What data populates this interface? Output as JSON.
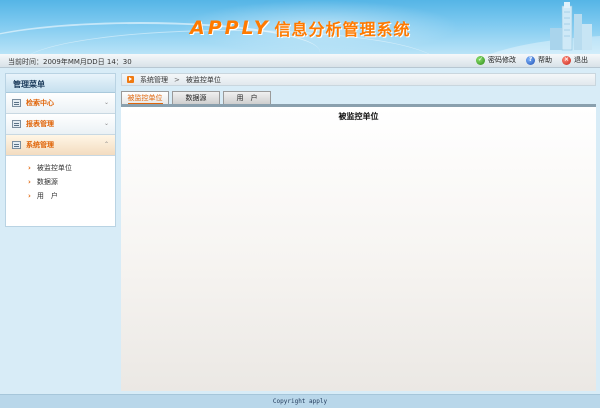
{
  "header": {
    "brand": "APPLY",
    "title": "信息分析管理系统"
  },
  "topbar": {
    "time_label": "当前时间：",
    "time_value": "2009年MM月DD日 14：30",
    "links": [
      {
        "label": "密码修改",
        "icon": "password-icon"
      },
      {
        "label": "帮助",
        "icon": "help-icon"
      },
      {
        "label": "退出",
        "icon": "exit-icon"
      }
    ]
  },
  "sidebar": {
    "title": "管理菜单",
    "items": [
      {
        "label": "检索中心",
        "icon": "search-center-icon"
      },
      {
        "label": "报表管理",
        "icon": "report-icon"
      },
      {
        "label": "系统管理",
        "icon": "system-icon"
      }
    ],
    "sub_items": [
      {
        "label": "被监控单位"
      },
      {
        "label": "数据源"
      },
      {
        "label": "用　户"
      }
    ]
  },
  "breadcrumb": {
    "items": [
      "系统管理",
      "被监控单位"
    ],
    "separator": ">"
  },
  "tabs": [
    {
      "label": "被监控单位",
      "active": true
    },
    {
      "label": "数据源",
      "active": false
    },
    {
      "label": "用　户",
      "active": false
    }
  ],
  "panel": {
    "title": "被监控单位"
  },
  "footer": {
    "text": "Copyright  apply"
  },
  "colors": {
    "accent": "#e0650a",
    "header_blue": "#55b5e6",
    "footer_bg": "#b9d7ea"
  }
}
